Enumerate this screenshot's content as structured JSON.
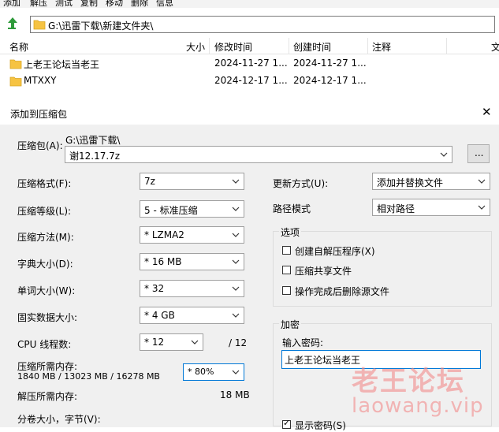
{
  "menu": [
    "添加",
    "解压",
    "测试",
    "复制",
    "移动",
    "删除",
    "信息"
  ],
  "path": "G:\\迅雷下载\\新建文件夹\\",
  "columns": [
    "名称",
    "大小",
    "修改时间",
    "创建时间",
    "注释",
    "文"
  ],
  "files": [
    {
      "name": "上老王论坛当老王",
      "modified": "2024-11-27 1...",
      "created": "2024-11-27 1..."
    },
    {
      "name": "MTXXY",
      "modified": "2024-12-17 1...",
      "created": "2024-12-17 1..."
    }
  ],
  "dialog": {
    "title": "添加到压缩包",
    "close": "✕",
    "archive_label": "压缩包(A):",
    "archive_dir": "G:\\迅雷下载\\",
    "archive_name": "谢12.17.7z",
    "browse": "...",
    "format_label": "压缩格式(F):",
    "format_value": "7z",
    "level_label": "压缩等级(L):",
    "level_value": "5 - 标准压缩",
    "method_label": "压缩方法(M):",
    "method_value": "* LZMA2",
    "dict_label": "字典大小(D):",
    "dict_value": "* 16 MB",
    "word_label": "单词大小(W):",
    "word_value": "* 32",
    "solid_label": "固实数据大小:",
    "solid_value": "* 4 GB",
    "cpu_label": "CPU 线程数:",
    "cpu_value": "* 12",
    "cpu_total": "/ 12",
    "mem_label": "压缩所需内存:",
    "mem_detail": "1840 MB / 13023 MB / 16278 MB",
    "mem_value": "* 80%",
    "dmem_label": "解压所需内存:",
    "dmem_value": "18 MB",
    "split_label": "分卷大小，字节(V):",
    "update_label": "更新方式(U):",
    "update_value": "添加并替换文件",
    "pathmode_label": "路径模式",
    "pathmode_value": "相对路径",
    "options_title": "选项",
    "opt_sfx": "创建自解压程序(X)",
    "opt_shared": "压缩共享文件",
    "opt_delete": "操作完成后删除源文件",
    "enc_title": "加密",
    "pwd_label": "输入密码:",
    "pwd_value": "上老王论坛当老王",
    "show_pwd": "显示密码(S)"
  },
  "watermark": {
    "text1": "老王论坛",
    "text2": "laowang.vip"
  },
  "colors": {
    "folder": "#f6c342",
    "focus": "#0078d7",
    "watermark": "#f28c8c"
  }
}
